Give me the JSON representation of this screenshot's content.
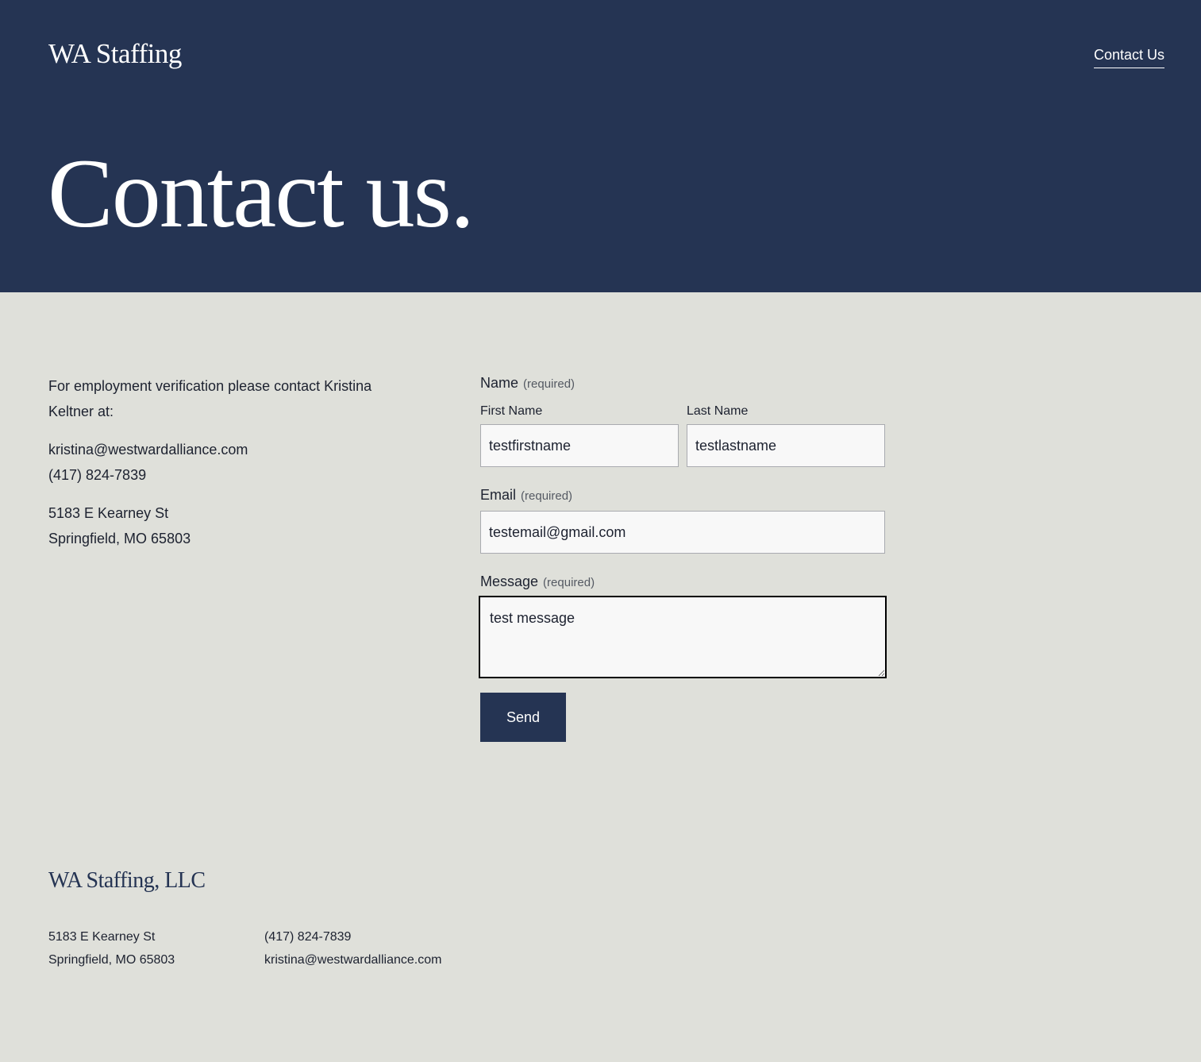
{
  "header": {
    "logo": "WA Staffing",
    "nav_link": "Contact Us"
  },
  "hero": {
    "title": "Contact us."
  },
  "info": {
    "intro": "For employment verification please contact Kristina Keltner at:",
    "email": "kristina@westwardalliance.com",
    "phone": "(417) 824-7839",
    "address_line1": "5183 E Kearney St",
    "address_line2": "Springfield, MO 65803"
  },
  "form": {
    "name_label": "Name",
    "required_text": "(required)",
    "first_name_label": "First Name",
    "first_name_value": "testfirstname",
    "last_name_label": "Last Name",
    "last_name_value": "testlastname",
    "email_label": "Email",
    "email_value": "testemail@gmail.com",
    "message_label": "Message",
    "message_value": "test message",
    "send_label": "Send"
  },
  "footer": {
    "logo": "WA Staffing, LLC",
    "address_line1": "5183 E Kearney St",
    "address_line2": "Springfield, MO 65803",
    "phone": "(417) 824-7839",
    "email": "kristina@westwardalliance.com"
  },
  "colors": {
    "navy": "#253453",
    "background": "#dfe0da",
    "input_bg": "#f8f8f8"
  }
}
